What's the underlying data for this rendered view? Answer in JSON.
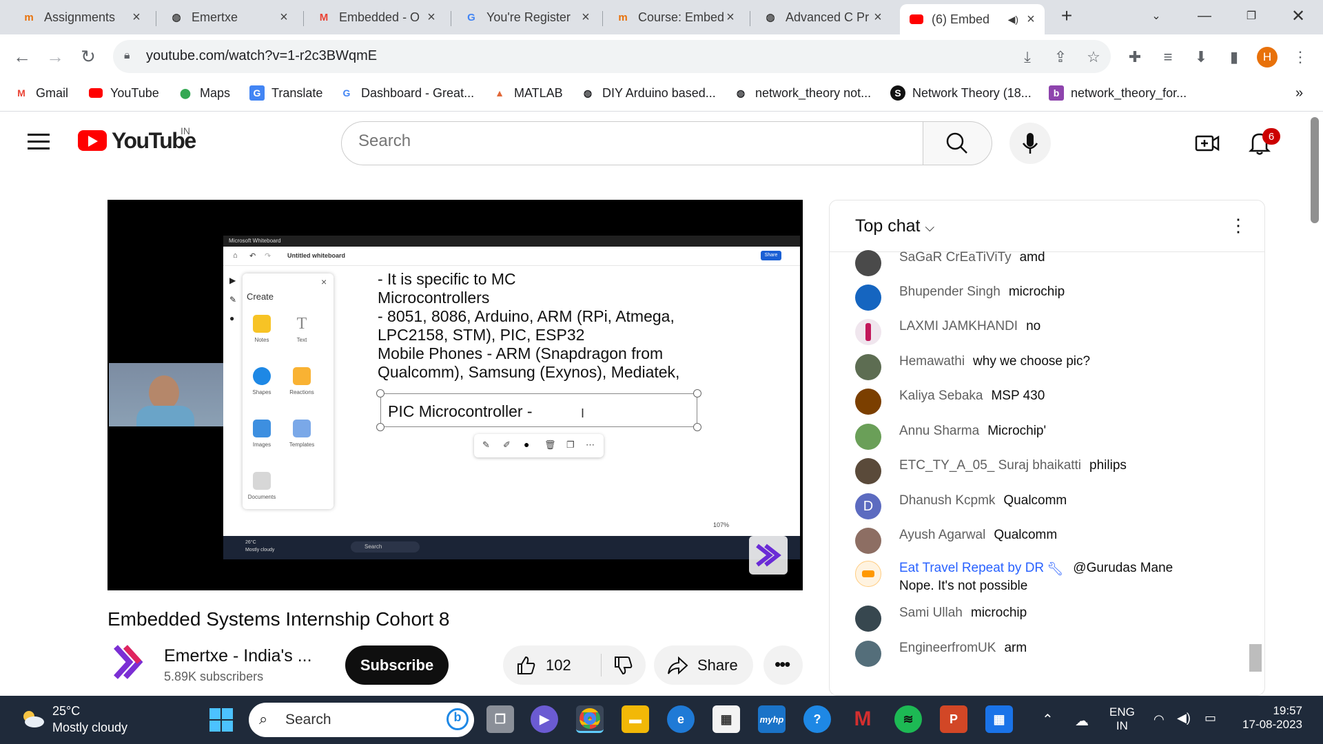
{
  "browser": {
    "tabs": [
      {
        "title": "Assignments",
        "favicon": "mentor-icon",
        "color": "#e8710a"
      },
      {
        "title": "Emertxe",
        "favicon": "globe-icon",
        "color": "#5f6368"
      },
      {
        "title": "Embedded - O",
        "favicon": "gmail-icon",
        "color": "#ea4335"
      },
      {
        "title": "You're Register",
        "favicon": "google-icon",
        "color": "#4285f4"
      },
      {
        "title": "Course: Embed",
        "favicon": "mentor-icon",
        "color": "#e8710a"
      },
      {
        "title": "Advanced C Pr",
        "favicon": "globe-icon",
        "color": "#5f6368"
      },
      {
        "title": "(6) Embed",
        "favicon": "youtube-icon",
        "color": "#ff0000",
        "active": true
      }
    ],
    "url": "youtube.com/watch?v=1-r2c3BWqmE",
    "profile_initial": "H",
    "bookmarks": [
      {
        "label": "Gmail"
      },
      {
        "label": "YouTube"
      },
      {
        "label": "Maps"
      },
      {
        "label": "Translate"
      },
      {
        "label": "Dashboard - Great..."
      },
      {
        "label": "MATLAB"
      },
      {
        "label": "DIY Arduino based..."
      },
      {
        "label": "network_theory not..."
      },
      {
        "label": "Network Theory (18..."
      },
      {
        "label": "network_theory_for..."
      }
    ],
    "more_bookmarks": "»"
  },
  "youtube": {
    "logo_text": "YouTube",
    "country": "IN",
    "search_placeholder": "Search",
    "notification_count": "6"
  },
  "video": {
    "whiteboard": {
      "app_title": "Microsoft Whiteboard",
      "doc_title": "Untitled whiteboard",
      "share_label": "Share",
      "panel_title": "Create",
      "tools": [
        "Notes",
        "Text",
        "Shapes",
        "Reactions",
        "Images",
        "Templates",
        "Documents"
      ],
      "lines": [
        "- It is specific to MC",
        "Microcontrollers",
        "- 8051, 8086, Arduino, ARM (RPi, Atmega,",
        "LPC2158, STM), PIC, ESP32",
        "Mobile Phones - ARM (Snapdragon from",
        "Qualcomm), Samsung (Exynos), Mediatek,"
      ],
      "selected_text": "PIC Microcontroller -",
      "zoom": "107%",
      "inner_weather_temp": "26°C",
      "inner_weather_desc": "Mostly cloudy",
      "inner_search": "Search"
    },
    "title": "Embedded Systems Internship Cohort 8",
    "channel_name": "Emertxe - India's ...",
    "subscribers": "5.89K subscribers",
    "subscribe_label": "Subscribe",
    "likes": "102",
    "share_label": "Share"
  },
  "chat": {
    "title": "Top chat",
    "messages": [
      {
        "author": "SaGaR CrEaTiViTy",
        "text": "amd",
        "avatar_color": "#4a4a4a"
      },
      {
        "author": "Bhupender Singh",
        "text": "microchip",
        "avatar_color": "#1565c0"
      },
      {
        "author": "LAXMI JAMKHANDI",
        "text": "no",
        "avatar_color": "#c2185b"
      },
      {
        "author": "Hemawathi",
        "text": "why we choose pic?",
        "avatar_color": "#5d6d52"
      },
      {
        "author": "Kaliya Sebaka",
        "text": "MSP 430",
        "avatar_color": "#7b3f00"
      },
      {
        "author": "Annu Sharma",
        "text": "Microchip'",
        "avatar_color": "#6a9f58"
      },
      {
        "author": "ETC_TY_A_05_ Suraj bhaikatti",
        "text": "philips",
        "avatar_color": "#5a4a3a"
      },
      {
        "author": "Dhanush Kcpmk",
        "text": "Qualcomm",
        "avatar_color": "#5c6bc0",
        "initial": "D"
      },
      {
        "author": "Ayush Agarwal",
        "text": "Qualcomm",
        "avatar_color": "#8d6e63"
      },
      {
        "author": "Eat Travel Repeat by DR",
        "text": "@Gurudas Mane",
        "text2": "Nope. It's not possible",
        "avatar_color": "#ff9800",
        "owner": true
      },
      {
        "author": "Sami Ullah",
        "text": "microchip",
        "avatar_color": "#37474f"
      },
      {
        "author": "EngineerfromUK",
        "text": "arm",
        "avatar_color": "#546e7a"
      }
    ]
  },
  "taskbar": {
    "weather_temp": "25°C",
    "weather_desc": "Mostly cloudy",
    "search_placeholder": "Search",
    "lang_top": "ENG",
    "lang_bottom": "IN",
    "time": "19:57",
    "date": "17-08-2023"
  }
}
